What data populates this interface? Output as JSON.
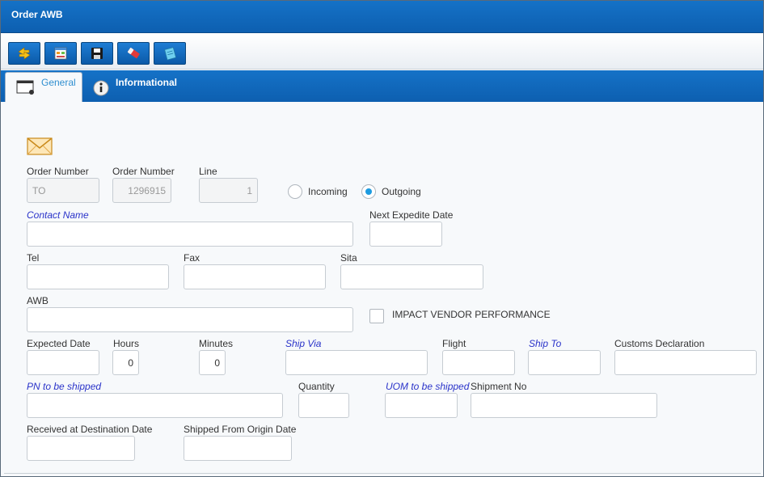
{
  "window": {
    "title": "Order AWB"
  },
  "toolbar": {
    "buttons": [
      {
        "icon": "refresh-icon"
      },
      {
        "icon": "form-icon"
      },
      {
        "icon": "save-icon"
      },
      {
        "icon": "eraser-icon"
      },
      {
        "icon": "note-icon"
      }
    ]
  },
  "tabs": {
    "general": "General",
    "informational": "Informational"
  },
  "form": {
    "order_number_label": "Order Number",
    "order_prefix_value": "TO",
    "order_number_label2": "Order Number",
    "order_number_value": "1296915",
    "line_label": "Line",
    "line_value": "1",
    "incoming_label": "Incoming",
    "outgoing_label": "Outgoing",
    "direction_selected": "Outgoing",
    "contact_name_label": "Contact Name",
    "contact_name_value": "",
    "next_expedite_label": "Next Expedite Date",
    "tel_label": "Tel",
    "fax_label": "Fax",
    "sita_label": "Sita",
    "awb_label": "AWB",
    "impact_vendor_label": "IMPACT VENDOR PERFORMANCE",
    "expected_date_label": "Expected Date",
    "hours_label": "Hours",
    "hours_value": "0",
    "minutes_label": "Minutes",
    "minutes_value": "0",
    "ship_via_label": "Ship Via",
    "flight_label": "Flight",
    "ship_to_label": "Ship To",
    "customs_label": "Customs Declaration",
    "pn_label": "PN to be shipped",
    "quantity_label": "Quantity",
    "uom_label": "UOM to be shipped",
    "shipment_no_label": "Shipment No",
    "received_label": "Received at Destination Date",
    "shipped_label": "Shipped From Origin Date"
  },
  "colors": {
    "header_blue": "#1572c7",
    "link_blue": "#2a33c9",
    "radio_blue": "#1d9be0"
  }
}
